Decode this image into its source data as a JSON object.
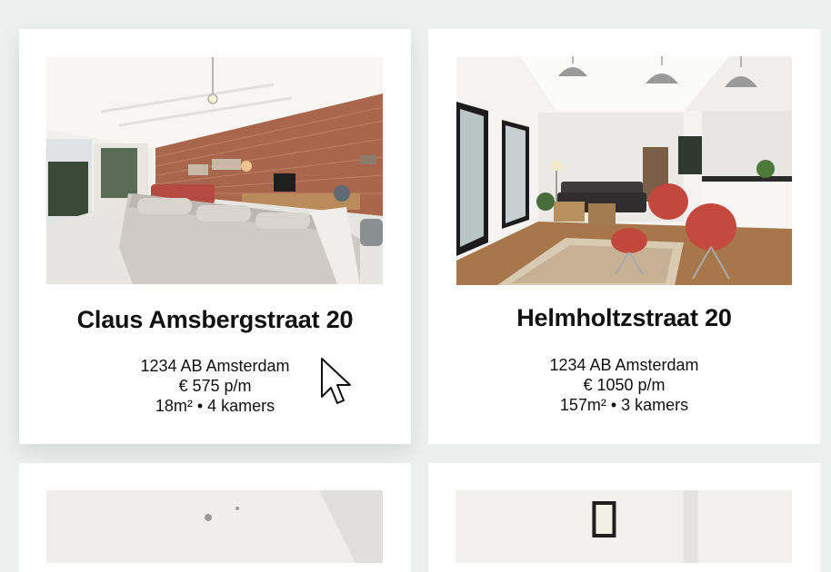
{
  "listings": [
    {
      "title": "Claus Amsbergstraat 20",
      "address": "1234 AB Amsterdam",
      "price": "€ 575 p/m",
      "details": "18m² • 4 kamers",
      "photo": "living-room-brick-wall-photo"
    },
    {
      "title": "Helmholtzstraat 20",
      "address": "1234 AB Amsterdam",
      "price": "€ 1050 p/m",
      "details": "157m² • 3 kamers",
      "photo": "living-room-red-chairs-photo"
    },
    {
      "photo": "listing-photo"
    },
    {
      "photo": "listing-photo"
    }
  ],
  "colors": {
    "page_background": "#eef0f0",
    "card_background": "#ffffff",
    "text": "#111111"
  },
  "cursor": "arrow-cursor-icon"
}
